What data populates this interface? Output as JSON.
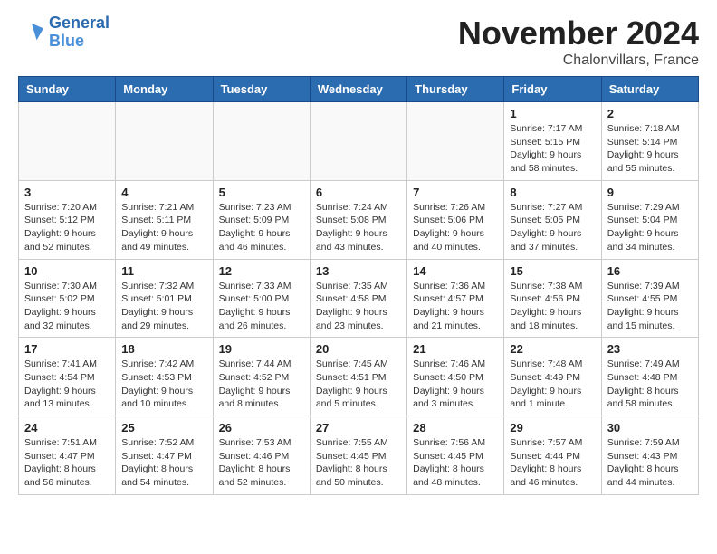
{
  "header": {
    "logo_line1": "General",
    "logo_line2": "Blue",
    "month_title": "November 2024",
    "location": "Chalonvillars, France"
  },
  "days_of_week": [
    "Sunday",
    "Monday",
    "Tuesday",
    "Wednesday",
    "Thursday",
    "Friday",
    "Saturday"
  ],
  "weeks": [
    [
      {
        "day": "",
        "info": ""
      },
      {
        "day": "",
        "info": ""
      },
      {
        "day": "",
        "info": ""
      },
      {
        "day": "",
        "info": ""
      },
      {
        "day": "",
        "info": ""
      },
      {
        "day": "1",
        "info": "Sunrise: 7:17 AM\nSunset: 5:15 PM\nDaylight: 9 hours and 58 minutes."
      },
      {
        "day": "2",
        "info": "Sunrise: 7:18 AM\nSunset: 5:14 PM\nDaylight: 9 hours and 55 minutes."
      }
    ],
    [
      {
        "day": "3",
        "info": "Sunrise: 7:20 AM\nSunset: 5:12 PM\nDaylight: 9 hours and 52 minutes."
      },
      {
        "day": "4",
        "info": "Sunrise: 7:21 AM\nSunset: 5:11 PM\nDaylight: 9 hours and 49 minutes."
      },
      {
        "day": "5",
        "info": "Sunrise: 7:23 AM\nSunset: 5:09 PM\nDaylight: 9 hours and 46 minutes."
      },
      {
        "day": "6",
        "info": "Sunrise: 7:24 AM\nSunset: 5:08 PM\nDaylight: 9 hours and 43 minutes."
      },
      {
        "day": "7",
        "info": "Sunrise: 7:26 AM\nSunset: 5:06 PM\nDaylight: 9 hours and 40 minutes."
      },
      {
        "day": "8",
        "info": "Sunrise: 7:27 AM\nSunset: 5:05 PM\nDaylight: 9 hours and 37 minutes."
      },
      {
        "day": "9",
        "info": "Sunrise: 7:29 AM\nSunset: 5:04 PM\nDaylight: 9 hours and 34 minutes."
      }
    ],
    [
      {
        "day": "10",
        "info": "Sunrise: 7:30 AM\nSunset: 5:02 PM\nDaylight: 9 hours and 32 minutes."
      },
      {
        "day": "11",
        "info": "Sunrise: 7:32 AM\nSunset: 5:01 PM\nDaylight: 9 hours and 29 minutes."
      },
      {
        "day": "12",
        "info": "Sunrise: 7:33 AM\nSunset: 5:00 PM\nDaylight: 9 hours and 26 minutes."
      },
      {
        "day": "13",
        "info": "Sunrise: 7:35 AM\nSunset: 4:58 PM\nDaylight: 9 hours and 23 minutes."
      },
      {
        "day": "14",
        "info": "Sunrise: 7:36 AM\nSunset: 4:57 PM\nDaylight: 9 hours and 21 minutes."
      },
      {
        "day": "15",
        "info": "Sunrise: 7:38 AM\nSunset: 4:56 PM\nDaylight: 9 hours and 18 minutes."
      },
      {
        "day": "16",
        "info": "Sunrise: 7:39 AM\nSunset: 4:55 PM\nDaylight: 9 hours and 15 minutes."
      }
    ],
    [
      {
        "day": "17",
        "info": "Sunrise: 7:41 AM\nSunset: 4:54 PM\nDaylight: 9 hours and 13 minutes."
      },
      {
        "day": "18",
        "info": "Sunrise: 7:42 AM\nSunset: 4:53 PM\nDaylight: 9 hours and 10 minutes."
      },
      {
        "day": "19",
        "info": "Sunrise: 7:44 AM\nSunset: 4:52 PM\nDaylight: 9 hours and 8 minutes."
      },
      {
        "day": "20",
        "info": "Sunrise: 7:45 AM\nSunset: 4:51 PM\nDaylight: 9 hours and 5 minutes."
      },
      {
        "day": "21",
        "info": "Sunrise: 7:46 AM\nSunset: 4:50 PM\nDaylight: 9 hours and 3 minutes."
      },
      {
        "day": "22",
        "info": "Sunrise: 7:48 AM\nSunset: 4:49 PM\nDaylight: 9 hours and 1 minute."
      },
      {
        "day": "23",
        "info": "Sunrise: 7:49 AM\nSunset: 4:48 PM\nDaylight: 8 hours and 58 minutes."
      }
    ],
    [
      {
        "day": "24",
        "info": "Sunrise: 7:51 AM\nSunset: 4:47 PM\nDaylight: 8 hours and 56 minutes."
      },
      {
        "day": "25",
        "info": "Sunrise: 7:52 AM\nSunset: 4:47 PM\nDaylight: 8 hours and 54 minutes."
      },
      {
        "day": "26",
        "info": "Sunrise: 7:53 AM\nSunset: 4:46 PM\nDaylight: 8 hours and 52 minutes."
      },
      {
        "day": "27",
        "info": "Sunrise: 7:55 AM\nSunset: 4:45 PM\nDaylight: 8 hours and 50 minutes."
      },
      {
        "day": "28",
        "info": "Sunrise: 7:56 AM\nSunset: 4:45 PM\nDaylight: 8 hours and 48 minutes."
      },
      {
        "day": "29",
        "info": "Sunrise: 7:57 AM\nSunset: 4:44 PM\nDaylight: 8 hours and 46 minutes."
      },
      {
        "day": "30",
        "info": "Sunrise: 7:59 AM\nSunset: 4:43 PM\nDaylight: 8 hours and 44 minutes."
      }
    ]
  ]
}
